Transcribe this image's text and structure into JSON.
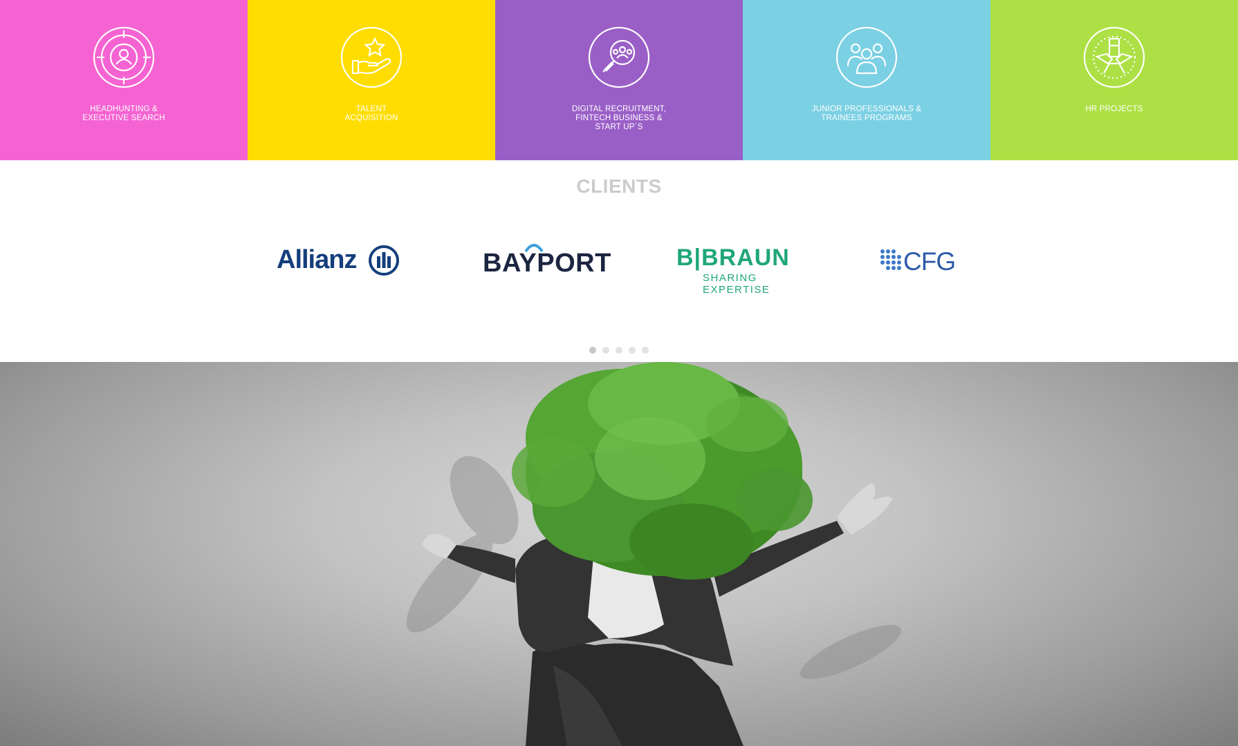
{
  "services": [
    {
      "label": "HEADHUNTING &\nEXECUTIVE SEARCH",
      "color": "#f563d2",
      "icon": "target-person-icon"
    },
    {
      "label": "TALENT\nACQUISITION",
      "color": "#ffdd00",
      "icon": "hand-star-icon"
    },
    {
      "label": "DIGITAL RECRUITMENT,\nFINTECH BUSINESS &\nSTART UP´S",
      "color": "#9a5fc7",
      "icon": "magnifier-people-icon"
    },
    {
      "label": "JUNIOR PROFESSIONALS &\nTRAINEES PROGRAMS",
      "color": "#7bd0e3",
      "icon": "group-people-icon"
    },
    {
      "label": "HR PROJECTS",
      "color": "#ade045",
      "icon": "hands-together-icon"
    }
  ],
  "clients": {
    "title": "CLIENTS",
    "logos": {
      "allianz": "Allianz",
      "bayport": "BAYPORT",
      "bbraun_main": "B|BRAUN",
      "bbraun_tagline": "SHARING EXPERTISE",
      "cfg": "CFG"
    },
    "slide_count": 5,
    "active_slide": 1
  },
  "colors": {
    "allianz": "#143e7c",
    "bayport_text": "#1c2540",
    "bayport_accent": "#3aa0dc",
    "bbraun": "#1fa67a",
    "cfg_text": "#2d5aa8",
    "cfg_dot": "#3c78c8"
  }
}
